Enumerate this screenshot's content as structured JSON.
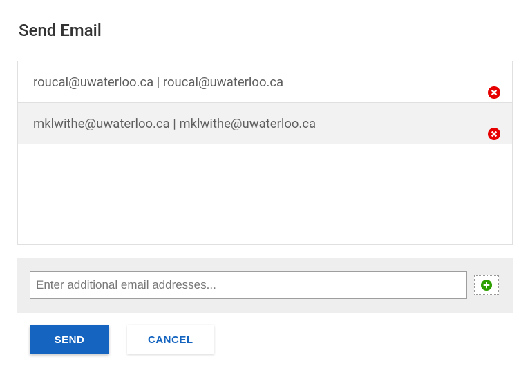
{
  "title": "Send Email",
  "recipients": [
    {
      "display": "roucal@uwaterloo.ca | roucal@uwaterloo.ca"
    },
    {
      "display": "mklwithe@uwaterloo.ca | mklwithe@uwaterloo.ca"
    }
  ],
  "input": {
    "placeholder": "Enter additional email addresses...",
    "value": ""
  },
  "buttons": {
    "send": "Send",
    "cancel": "Cancel"
  },
  "colors": {
    "primary": "#1565c0",
    "danger": "#e60000",
    "success": "#2e9f00"
  }
}
